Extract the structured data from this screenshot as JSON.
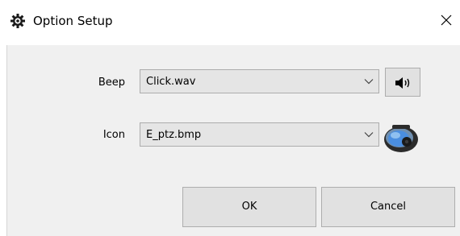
{
  "window": {
    "title": "Option Setup"
  },
  "form": {
    "beep": {
      "label": "Beep",
      "value": "Click.wav"
    },
    "icon": {
      "label": "Icon",
      "value": "E_ptz.bmp"
    }
  },
  "buttons": {
    "ok_label": "OK",
    "cancel_label": "Cancel"
  },
  "icons": {
    "app": "gear-icon",
    "close": "close-icon",
    "dropdown": "chevron-down-icon",
    "speaker": "speaker-icon",
    "camera_preview": "ptz-camera-icon"
  },
  "colors": {
    "client_bg": "#f0f0f0",
    "button_bg": "#e1e1e1",
    "combo_bg": "#e5e5e5",
    "border": "#adadad",
    "camera_blue": "#3a7bd5"
  }
}
